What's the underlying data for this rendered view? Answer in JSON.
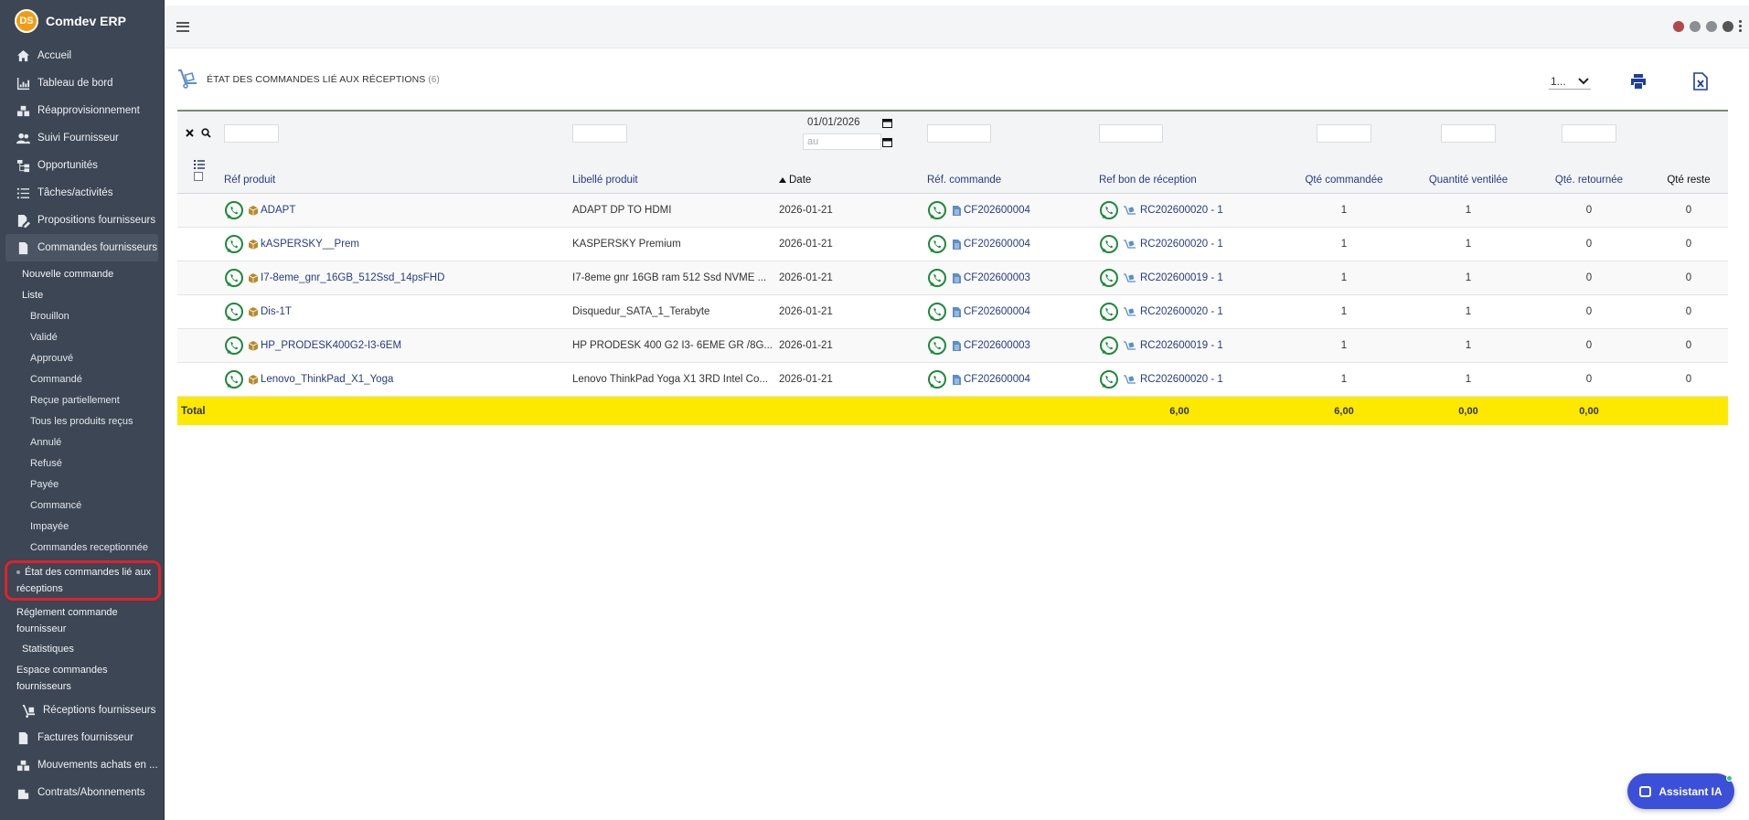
{
  "app": {
    "name": "Comdev ERP",
    "logo_text": "DS"
  },
  "sidebar": {
    "main_items": [
      {
        "label": "Accueil",
        "icon": "home-icon"
      },
      {
        "label": "Tableau de bord",
        "icon": "chart-icon"
      },
      {
        "label": "Réapprovisionnement",
        "icon": "boxes-icon"
      },
      {
        "label": "Suivi Fournisseur",
        "icon": "users-icon"
      },
      {
        "label": "Opportunités",
        "icon": "sitemap-icon"
      },
      {
        "label": "Tâches/activités",
        "icon": "tasks-icon"
      },
      {
        "label": "Propositions fournisseurs",
        "icon": "file-edit-icon"
      },
      {
        "label": "Commandes fournisseurs",
        "icon": "file-icon"
      }
    ],
    "sub_items": {
      "new_order": "Nouvelle commande",
      "list": "Liste",
      "statuses": [
        "Brouillon",
        "Validé",
        "Approuvé",
        "Commandé",
        "Reçue partiellement",
        "Tous les produits reçus",
        "Annulé",
        "Refusé",
        "Payée",
        "Commancé",
        "Impayée",
        "Commandes receptionnée"
      ],
      "active": "État des commandes lié aux réceptions",
      "payment": "Réglement commande fournisseur",
      "stats": "Statistiques",
      "space": "Espace commandes fournisseurs"
    },
    "bottom_items": [
      {
        "label": "Réceptions fournisseurs",
        "icon": "dolly-icon"
      },
      {
        "label": "Factures fournisseur",
        "icon": "invoice-icon"
      },
      {
        "label": "Mouvements achats en ...",
        "icon": "boxes-icon"
      },
      {
        "label": "Contrats/Abonnements",
        "icon": "building-icon"
      }
    ]
  },
  "page": {
    "title": "ÉTAT DES COMMANDES LIÉ AUX RÉCEPTIONS",
    "count": "(6)",
    "limit_value": "1..."
  },
  "filters": {
    "date_from": "01/01/2026",
    "date_to_placeholder": "au"
  },
  "table": {
    "headers": {
      "ref_produit": "Réf produit",
      "libelle": "Libellé produit",
      "date": "Date",
      "ref_commande": "Réf. commande",
      "ref_bon": "Ref bon de réception",
      "qte_commandee": "Qté commandée",
      "qte_ventilee": "Quantité ventilée",
      "qte_retournee": "Qté. retournée",
      "qte_reste": "Qté reste"
    },
    "rows": [
      {
        "ref": "ADAPT",
        "libelle": "ADAPT DP TO HDMI",
        "date": "2026-01-21",
        "commande": "CF202600004",
        "bon": "RC202600020 - 1",
        "commandee": "1",
        "ventilee": "1",
        "retournee": "0",
        "reste": "0"
      },
      {
        "ref": "kASPERSKY__Prem",
        "libelle": "KASPERSKY Premium",
        "date": "2026-01-21",
        "commande": "CF202600004",
        "bon": "RC202600020 - 1",
        "commandee": "1",
        "ventilee": "1",
        "retournee": "0",
        "reste": "0"
      },
      {
        "ref": "I7-8eme_gnr_16GB_512Ssd_14psFHD",
        "libelle": "I7-8eme gnr 16GB ram 512 Ssd NVME ...",
        "date": "2026-01-21",
        "commande": "CF202600003",
        "bon": "RC202600019 - 1",
        "commandee": "1",
        "ventilee": "1",
        "retournee": "0",
        "reste": "0"
      },
      {
        "ref": "Dis-1T",
        "libelle": "Disquedur_SATA_1_Terabyte",
        "date": "2026-01-21",
        "commande": "CF202600004",
        "bon": "RC202600020 - 1",
        "commandee": "1",
        "ventilee": "1",
        "retournee": "0",
        "reste": "0"
      },
      {
        "ref": "HP_PRODESK400G2-I3-6EM",
        "libelle": "HP PRODESK 400 G2 I3- 6EME GR /8G...",
        "date": "2026-01-21",
        "commande": "CF202600003",
        "bon": "RC202600019 - 1",
        "commandee": "1",
        "ventilee": "1",
        "retournee": "0",
        "reste": "0"
      },
      {
        "ref": "Lenovo_ThinkPad_X1_Yoga",
        "libelle": "Lenovo ThinkPad Yoga X1 3RD Intel Co...",
        "date": "2026-01-21",
        "commande": "CF202600004",
        "bon": "RC202600020 - 1",
        "commandee": "1",
        "ventilee": "1",
        "retournee": "0",
        "reste": "0"
      }
    ],
    "total": {
      "label": "Total",
      "ref_bon": "6,00",
      "commandee": "6,00",
      "ventilee": "0,00",
      "retournee": "0,00"
    }
  },
  "assistant": {
    "label": "Assistant IA"
  },
  "colors": {
    "link": "#263c81",
    "total_bg": "#fde900",
    "sidebar_bg": "#3c4654",
    "whatsapp": "#1d8a3a",
    "highlight": "#e3202a"
  }
}
